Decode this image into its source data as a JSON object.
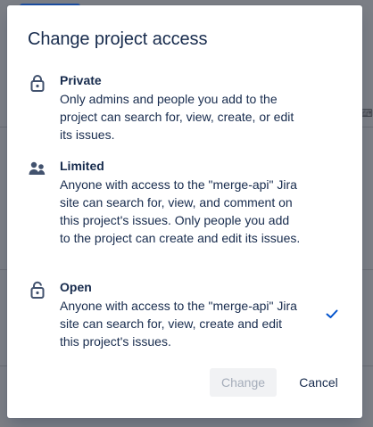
{
  "modal": {
    "title": "Change project access",
    "options": [
      {
        "name": "Private",
        "description": "Only admins and people you add to the project can search for, view, create, or edit its issues.",
        "icon": "lock-icon",
        "selected": false
      },
      {
        "name": "Limited",
        "description": "Anyone with access to the \"merge-api\" Jira site can search for, view, and comment on this project's issues. Only people you add to the project can create and edit its issues.",
        "icon": "people-icon",
        "selected": false
      },
      {
        "name": "Open",
        "description": "Anyone with access to the \"merge-api\" Jira site can search for, view, create and edit this project's issues.",
        "icon": "unlock-icon",
        "selected": true
      }
    ],
    "buttons": {
      "change_label": "Change",
      "cancel_label": "Cancel"
    }
  },
  "colors": {
    "text": "#172b4d",
    "icon": "#42526e",
    "check": "#0052cc",
    "disabled_text": "#a5adba",
    "disabled_bg": "#f1f2f4"
  }
}
